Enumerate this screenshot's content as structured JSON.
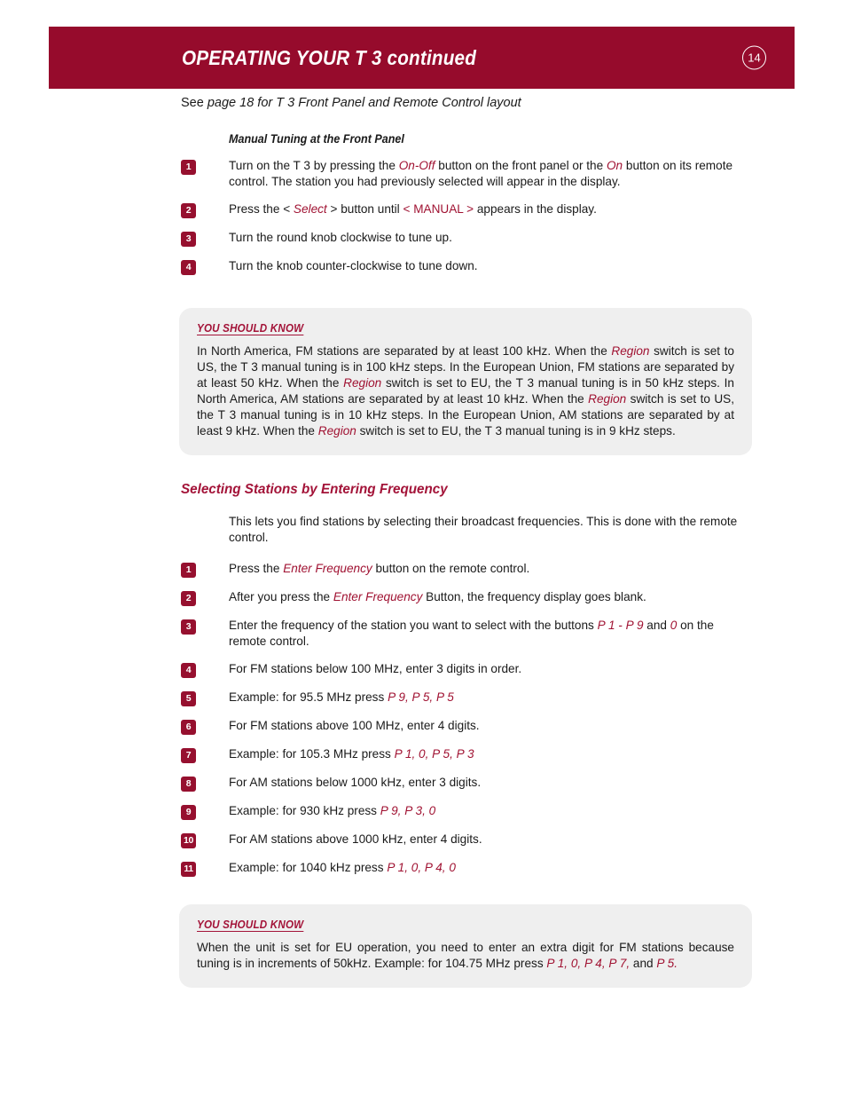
{
  "header": {
    "title": "OPERATING YOUR T 3 continued",
    "page_number": "14",
    "bar_color": "#960B2C"
  },
  "intro": {
    "prefix": "See ",
    "italic": "page 18 for T 3 Front Panel and Remote Control layout"
  },
  "section1": {
    "sub_heading": "Manual Tuning at the Front Panel",
    "steps": [
      {
        "num": "1",
        "parts": [
          {
            "t": "Turn on the T 3 by pressing the ",
            "s": "plain"
          },
          {
            "t": "On-Off",
            "s": "red-italic"
          },
          {
            "t": " button on the front panel or the ",
            "s": "plain"
          },
          {
            "t": "On",
            "s": "red-italic"
          },
          {
            "t": " button on its remote control. The station you had previously selected will appear in the display.",
            "s": "plain"
          }
        ]
      },
      {
        "num": "2",
        "parts": [
          {
            "t": "Press the < ",
            "s": "plain"
          },
          {
            "t": "Select",
            "s": "red-italic"
          },
          {
            "t": " > button until ",
            "s": "plain"
          },
          {
            "t": "< MANUAL >",
            "s": "red"
          },
          {
            "t": " appears in the display.",
            "s": "plain"
          }
        ]
      },
      {
        "num": "3",
        "parts": [
          {
            "t": "Turn the round knob clockwise to tune up.",
            "s": "plain"
          }
        ]
      },
      {
        "num": "4",
        "parts": [
          {
            "t": "Turn the knob counter-clockwise to tune down.",
            "s": "plain"
          }
        ]
      }
    ]
  },
  "ysk1": {
    "title": "YOU SHOULD KNOW",
    "parts": [
      {
        "t": "In North America, FM stations are separated by at least 100 kHz. When the ",
        "s": "plain"
      },
      {
        "t": "Region",
        "s": "red-italic"
      },
      {
        "t": " switch is set to US, the T 3 manual tuning is in 100 kHz steps. In the European Union, FM stations are separated by at least 50 kHz. When the ",
        "s": "plain"
      },
      {
        "t": "Region",
        "s": "red-italic"
      },
      {
        "t": " switch is set to EU, the T 3 manual tuning is in 50 kHz steps. In North America, AM stations are separated by at least 10 kHz. When the ",
        "s": "plain"
      },
      {
        "t": "Region",
        "s": "red-italic"
      },
      {
        "t": " switch is set to US, the T 3 manual tuning is in 10 kHz steps. In the European Union, AM stations are separated by at least 9 kHz. When the ",
        "s": "plain"
      },
      {
        "t": "Region",
        "s": "red-italic"
      },
      {
        "t": " switch is set to EU, the T 3 manual tuning is in 9 kHz steps.",
        "s": "plain"
      }
    ]
  },
  "section2": {
    "heading": "Selecting Stations by Entering Frequency",
    "lead": "This lets you find stations by selecting their broadcast frequencies. This is done with the remote control.",
    "steps": [
      {
        "num": "1",
        "parts": [
          {
            "t": "Press the ",
            "s": "plain"
          },
          {
            "t": "Enter Frequency",
            "s": "red-italic"
          },
          {
            "t": " button on the remote control.",
            "s": "plain"
          }
        ]
      },
      {
        "num": "2",
        "parts": [
          {
            "t": "After you press the ",
            "s": "plain"
          },
          {
            "t": "Enter Frequency",
            "s": "red-italic"
          },
          {
            "t": " Button, the frequency display goes blank.",
            "s": "plain"
          }
        ]
      },
      {
        "num": "3",
        "parts": [
          {
            "t": "Enter the frequency of the station you want to select with the buttons ",
            "s": "plain"
          },
          {
            "t": "P 1 - P 9",
            "s": "red-italic"
          },
          {
            "t": " and ",
            "s": "plain"
          },
          {
            "t": "0",
            "s": "red-italic"
          },
          {
            "t": " on the remote control.",
            "s": "plain"
          }
        ]
      },
      {
        "num": "4",
        "parts": [
          {
            "t": "For FM stations below 100 MHz, enter 3 digits in order.",
            "s": "plain"
          }
        ]
      },
      {
        "num": "5",
        "parts": [
          {
            "t": "Example: for 95.5 MHz press ",
            "s": "plain"
          },
          {
            "t": "P 9, P 5, P 5",
            "s": "red-italic"
          }
        ]
      },
      {
        "num": "6",
        "parts": [
          {
            "t": "For FM stations above 100 MHz, enter 4 digits.",
            "s": "plain"
          }
        ]
      },
      {
        "num": "7",
        "parts": [
          {
            "t": "Example: for 105.3 MHz press ",
            "s": "plain"
          },
          {
            "t": "P 1, 0, P 5, P 3",
            "s": "red-italic"
          }
        ]
      },
      {
        "num": "8",
        "parts": [
          {
            "t": "For AM stations below 1000 kHz, enter 3 digits.",
            "s": "plain"
          }
        ]
      },
      {
        "num": "9",
        "parts": [
          {
            "t": "Example: for 930 kHz press ",
            "s": "plain"
          },
          {
            "t": "P 9, P 3, 0",
            "s": "red-italic"
          }
        ]
      },
      {
        "num": "10",
        "parts": [
          {
            "t": "For AM stations above 1000 kHz, enter 4 digits.",
            "s": "plain"
          }
        ]
      },
      {
        "num": "11",
        "parts": [
          {
            "t": "Example: for 1040 kHz press ",
            "s": "plain"
          },
          {
            "t": "P 1, 0, P 4, 0",
            "s": "red-italic"
          }
        ]
      }
    ]
  },
  "ysk2": {
    "title": "YOU SHOULD KNOW",
    "parts": [
      {
        "t": "When the unit is set for EU operation, you need to enter an extra digit for FM stations because tuning is in increments of 50kHz. Example: for 104.75 MHz press ",
        "s": "plain"
      },
      {
        "t": "P 1, 0, P 4, P 7,",
        "s": "red-italic"
      },
      {
        "t": " and ",
        "s": "plain"
      },
      {
        "t": "P 5.",
        "s": "red-italic"
      }
    ]
  },
  "colors": {
    "brand_red": "#960B2C",
    "accent_red": "#A31338",
    "panel_gray": "#EFEFEF"
  }
}
